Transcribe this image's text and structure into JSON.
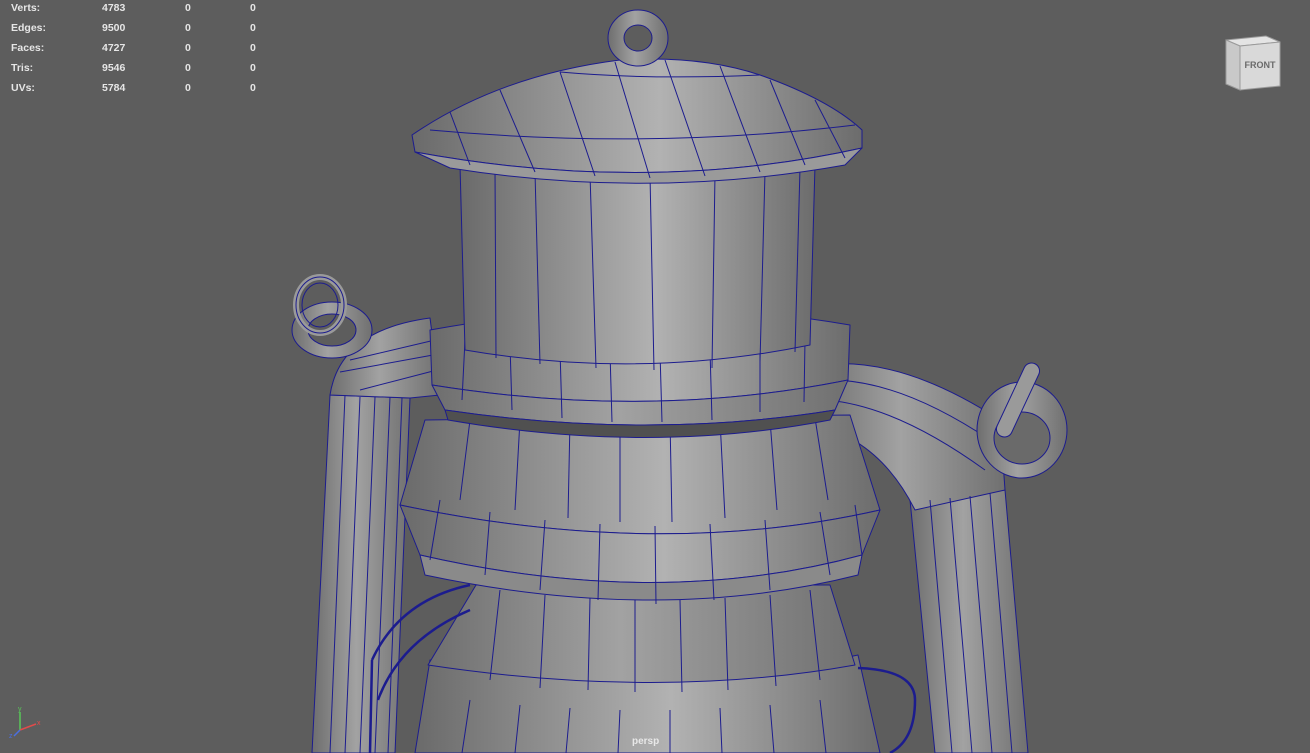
{
  "hud": {
    "rows": [
      {
        "label": "Verts:",
        "v1": "4783",
        "v2": "0",
        "v3": "0"
      },
      {
        "label": "Edges:",
        "v1": "9500",
        "v2": "0",
        "v3": "0"
      },
      {
        "label": "Faces:",
        "v1": "4727",
        "v2": "0",
        "v3": "0"
      },
      {
        "label": "Tris:",
        "v1": "9546",
        "v2": "0",
        "v3": "0"
      },
      {
        "label": "UVs:",
        "v1": "5784",
        "v2": "0",
        "v3": "0"
      }
    ]
  },
  "view_cube": {
    "face_label": "FRONT"
  },
  "camera": {
    "name": "persp"
  },
  "axis_gizmo": {
    "x": "x",
    "y": "y",
    "z": "z"
  },
  "colors": {
    "background": "#5d5d5d",
    "wire": "#1b1b8c",
    "mesh": "#8c8c8c"
  }
}
